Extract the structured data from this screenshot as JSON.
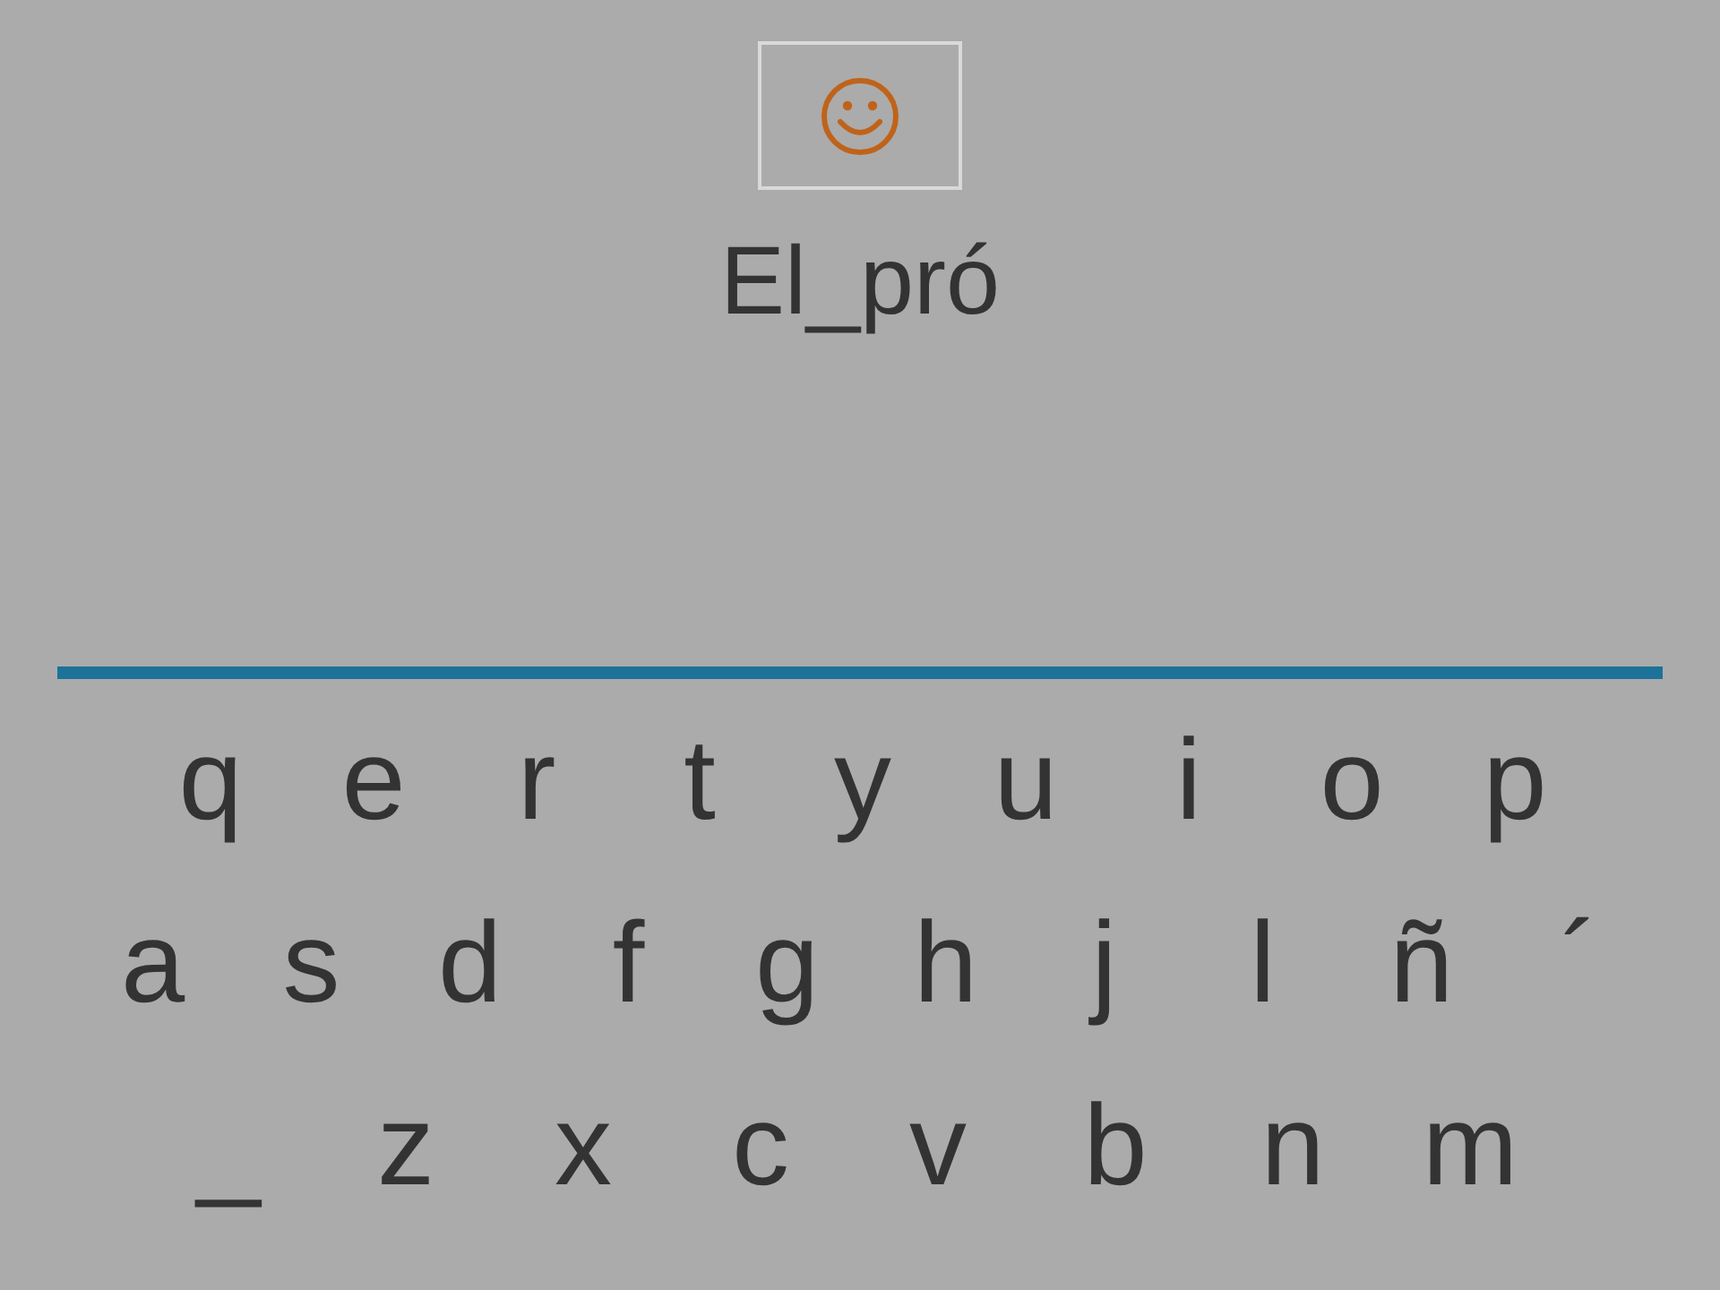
{
  "word": "El_pró",
  "keyboard": {
    "rows": [
      [
        "q",
        "e",
        "r",
        "t",
        "y",
        "u",
        "i",
        "o",
        "p"
      ],
      [
        "a",
        "s",
        "d",
        "f",
        "g",
        "h",
        "j",
        "l",
        "ñ",
        "´"
      ],
      [
        "_",
        "z",
        "x",
        "c",
        "v",
        "b",
        "n",
        "m"
      ]
    ]
  }
}
